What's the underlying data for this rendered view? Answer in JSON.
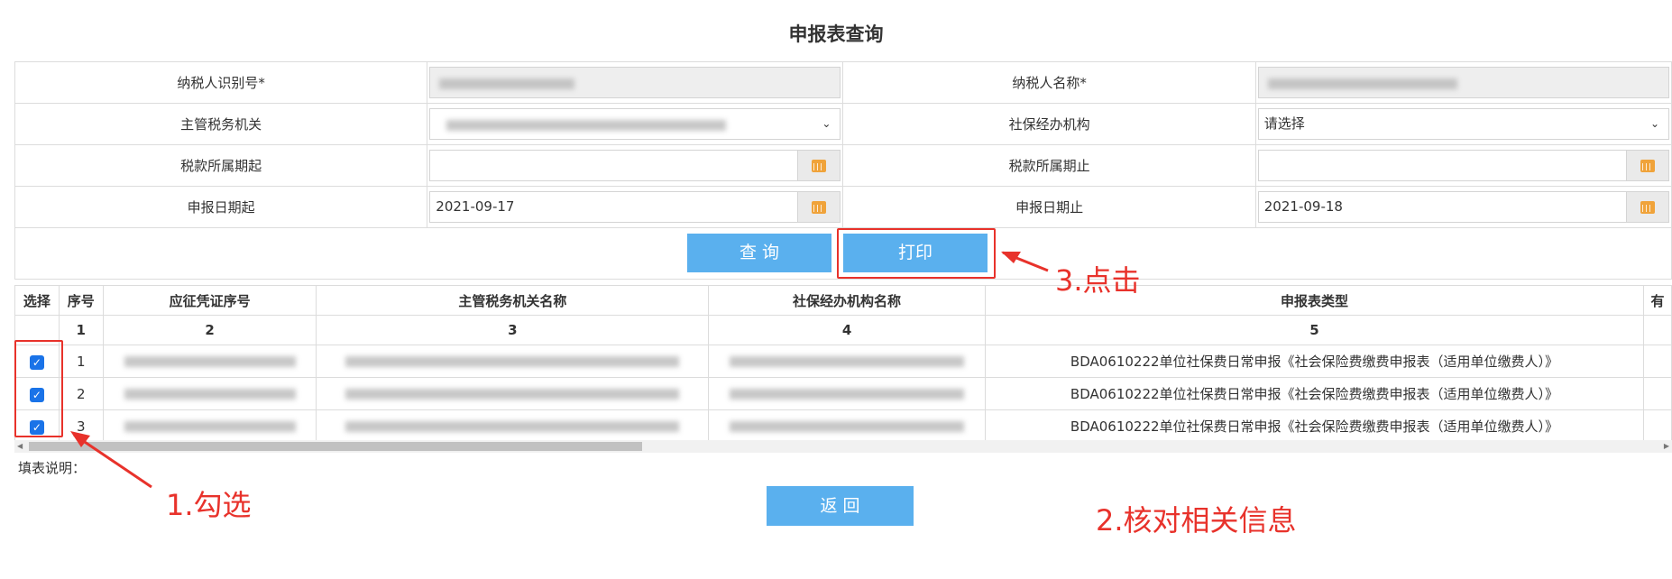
{
  "page": {
    "title": "申报表查询"
  },
  "form": {
    "taxpayer_id_label": "纳税人识别号*",
    "taxpayer_name_label": "纳税人名称*",
    "tax_authority_label": "主管税务机关",
    "agency_label": "社保经办机构",
    "agency_value": "请选择",
    "tax_period_start_label": "税款所属期起",
    "tax_period_end_label": "税款所属期止",
    "declare_date_start_label": "申报日期起",
    "declare_date_start_value": "2021-09-17",
    "declare_date_end_label": "申报日期止",
    "declare_date_end_value": "2021-09-18"
  },
  "buttons": {
    "query": "查 询",
    "print": "打印",
    "back": "返 回"
  },
  "table": {
    "headers": [
      "选择",
      "序号",
      "应征凭证序号",
      "主管税务机关名称",
      "社保经办机构名称",
      "申报表类型",
      "有"
    ],
    "column_numbers": [
      "",
      "1",
      "2",
      "3",
      "4",
      "5",
      ""
    ],
    "rows": [
      {
        "seq": "1",
        "type": "BDA0610222单位社保费日常申报《社会保险费缴费申报表（适用单位缴费人）》",
        "checked": true
      },
      {
        "seq": "2",
        "type": "BDA0610222单位社保费日常申报《社会保险费缴费申报表（适用单位缴费人）》",
        "checked": true
      },
      {
        "seq": "3",
        "type": "BDA0610222单位社保费日常申报《社会保险费缴费申报表（适用单位缴费人）》",
        "checked": true
      }
    ]
  },
  "note": "填表说明：",
  "annotations": {
    "step1": "1.勾选",
    "step2": "2.核对相关信息",
    "step3": "3.点击"
  },
  "colors": {
    "accent": "#5ab0ee",
    "annotation_red": "#e8322b",
    "calendar_icon": "#f0a33a"
  }
}
